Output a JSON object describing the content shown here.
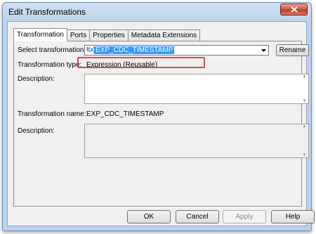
{
  "window": {
    "title": "Edit Transformations",
    "close_glyph": "✕"
  },
  "tabs": [
    {
      "label": "Transformation",
      "active": true
    },
    {
      "label": "Ports"
    },
    {
      "label": "Properties"
    },
    {
      "label": "Metadata Extensions"
    }
  ],
  "transformation": {
    "select_label": "Select transformation:",
    "select_icon": "f(x)",
    "select_value": "EXP_CDC_TIMESTAMP",
    "rename_label": "Rename",
    "type_label": "Transformation type:",
    "type_value": "Expression (Reusable)",
    "description_label": "Description:",
    "name_label": "Transformation name:",
    "name_value": "EXP_CDC_TIMESTAMP",
    "description2_label": "Description:"
  },
  "buttons": {
    "ok": "OK",
    "cancel": "Cancel",
    "apply": "Apply",
    "help": "Help"
  },
  "colors": {
    "highlight_box": "#d94a4a",
    "selection": "#3399ff"
  },
  "icons": {
    "close": "close-icon",
    "dropdown": "chevron-down-icon",
    "function": "function-icon"
  }
}
